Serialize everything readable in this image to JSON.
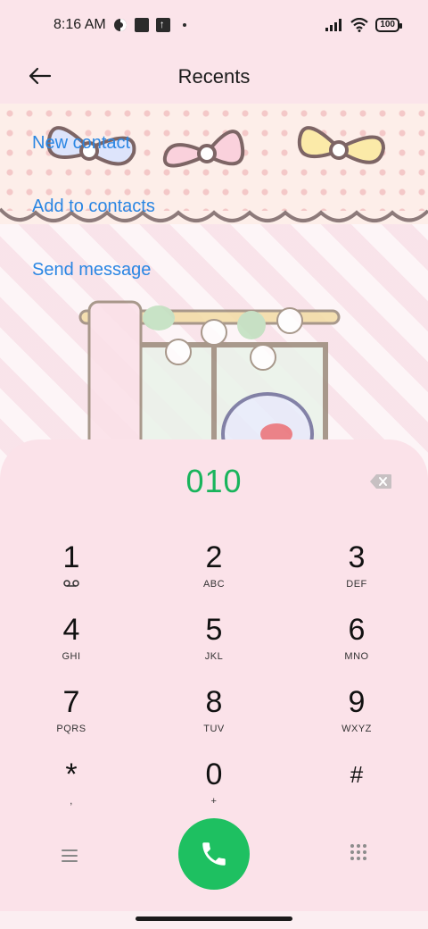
{
  "status_bar": {
    "time": "8:16 AM",
    "battery": "100",
    "icons": [
      "theme-icon",
      "square-notification-icon",
      "upload-icon",
      "dot-icon",
      "signal-icon",
      "wifi-icon",
      "battery-icon"
    ]
  },
  "header": {
    "title": "Recents",
    "back_icon": "arrow-left-icon"
  },
  "actions": {
    "new_contact": "New contact",
    "add_to_contacts": "Add to contacts",
    "send_message": "Send message"
  },
  "dialer": {
    "number": "010",
    "backspace_icon": "backspace-icon",
    "keys": [
      {
        "digit": "1",
        "letters": "",
        "sub_icon": "voicemail-icon"
      },
      {
        "digit": "2",
        "letters": "ABC"
      },
      {
        "digit": "3",
        "letters": "DEF"
      },
      {
        "digit": "4",
        "letters": "GHI"
      },
      {
        "digit": "5",
        "letters": "JKL"
      },
      {
        "digit": "6",
        "letters": "MNO"
      },
      {
        "digit": "7",
        "letters": "PQRS"
      },
      {
        "digit": "8",
        "letters": "TUV"
      },
      {
        "digit": "9",
        "letters": "WXYZ"
      },
      {
        "digit": "*",
        "letters": ","
      },
      {
        "digit": "0",
        "letters": "+"
      },
      {
        "digit": "#",
        "letters": ""
      }
    ],
    "bottom": {
      "menu_icon": "menu-icon",
      "call_icon": "phone-icon",
      "dialpad_icon": "dialpad-icon"
    }
  },
  "colors": {
    "accent_green": "#1ec061",
    "number_green": "#19b45c",
    "link_blue": "#2a86e3",
    "panel_pink": "#fbe2e9"
  }
}
